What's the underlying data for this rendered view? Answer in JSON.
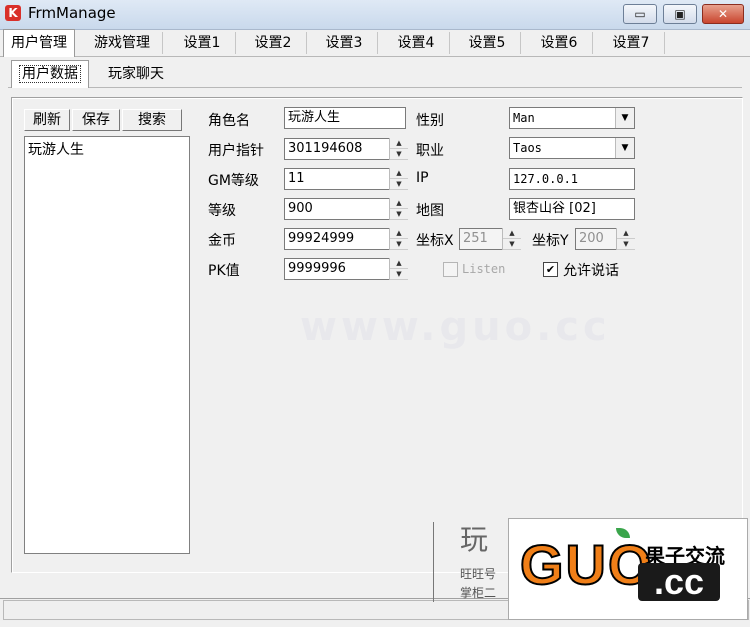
{
  "window": {
    "title": "FrmManage",
    "icon": "app-icon",
    "min": "▭",
    "max": "▣",
    "close": "✕"
  },
  "tabs": [
    "用户管理",
    "游戏管理",
    "设置1",
    "设置2",
    "设置3",
    "设置4",
    "设置5",
    "设置6",
    "设置7"
  ],
  "subtabs": [
    "用户数据",
    "玩家聊天"
  ],
  "buttons": {
    "refresh": "刷新",
    "save": "保存",
    "search": "搜索"
  },
  "list": [
    "玩游人生"
  ],
  "form": {
    "role_name_label": "角色名",
    "role_name": "玩游人生",
    "user_ptr_label": "用户指针",
    "user_ptr": "301194608",
    "gm_level_label": "GM等级",
    "gm_level": "11",
    "level_label": "等级",
    "level": "900",
    "gold_label": "金币",
    "gold": "99924999",
    "pk_label": "PK值",
    "pk": "9999996",
    "gender_label": "性别",
    "gender": "Man",
    "job_label": "职业",
    "job": "Taos",
    "ip_label": "IP",
    "ip": "127.0.0.1",
    "map_label": "地图",
    "map": "银杏山谷 [02]",
    "coord_x_label": "坐标X",
    "coord_x": "251",
    "coord_y_label": "坐标Y",
    "coord_y": "200",
    "listen_label": "Listen",
    "listen_checked": false,
    "allow_talk_label": "允许说话",
    "allow_talk_checked": true
  },
  "overlay": {
    "watermark": "www.guo.cc",
    "logo_big": "GUO",
    "logo_cc": ".cc",
    "logo_cn": "果子交流",
    "side_title": "玩",
    "side_line1": "旺旺号",
    "side_line2": "掌柜二"
  }
}
